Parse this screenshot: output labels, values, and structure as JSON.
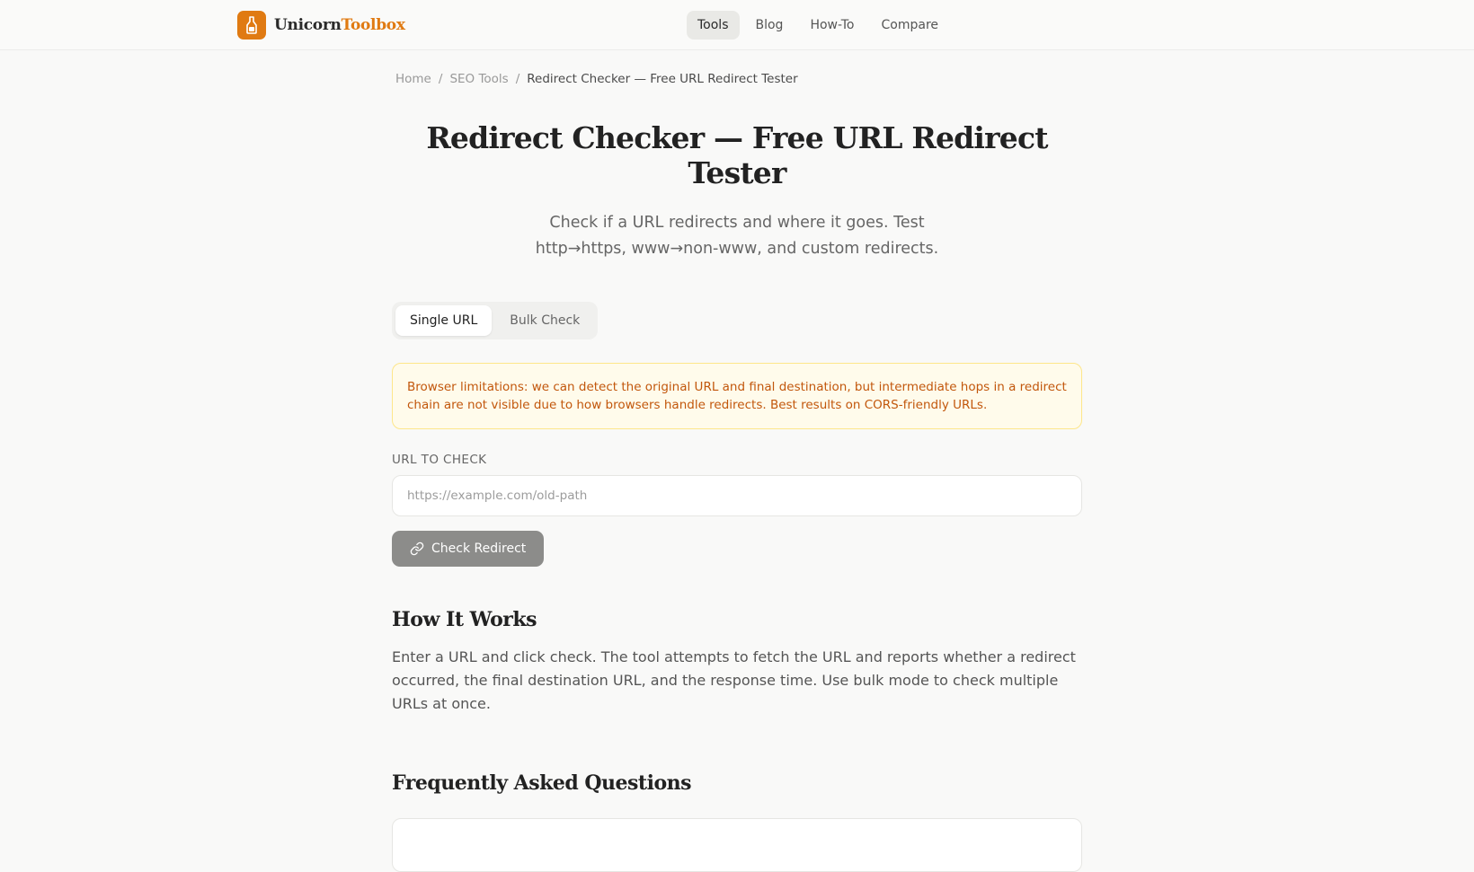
{
  "brand": {
    "name_part1": "Unicorn",
    "name_part2": "Toolbox",
    "accent": "#e07a12"
  },
  "nav": {
    "items": [
      {
        "label": "Tools",
        "active": true
      },
      {
        "label": "Blog",
        "active": false
      },
      {
        "label": "How-To",
        "active": false
      },
      {
        "label": "Compare",
        "active": false
      }
    ]
  },
  "breadcrumb": {
    "home": "Home",
    "sep": "/",
    "section": "SEO Tools",
    "current": "Redirect Checker — Free URL Redirect Tester"
  },
  "page": {
    "title": "Redirect Checker — Free URL Redirect Tester",
    "subtitle": "Check if a URL redirects and where it goes. Test http→https, www→non-www, and custom redirects."
  },
  "tabs": {
    "single": "Single URL",
    "bulk": "Bulk Check",
    "active": "single"
  },
  "notice": {
    "text": "Browser limitations: we can detect the original URL and final destination, but intermediate hops in a redirect chain are not visible due to how browsers handle redirects. Best results on CORS-friendly URLs."
  },
  "form": {
    "label": "URL TO CHECK",
    "placeholder": "https://example.com/old-path",
    "value": "",
    "button": "Check Redirect"
  },
  "how": {
    "title": "How It Works",
    "text": "Enter a URL and click check. The tool attempts to fetch the URL and reports whether a redirect occurred, the final destination URL, and the response time. Use bulk mode to check multiple URLs at once."
  },
  "faq": {
    "title": "Frequently Asked Questions"
  },
  "icons": {
    "logo": "bottle-icon",
    "button": "link-icon"
  }
}
